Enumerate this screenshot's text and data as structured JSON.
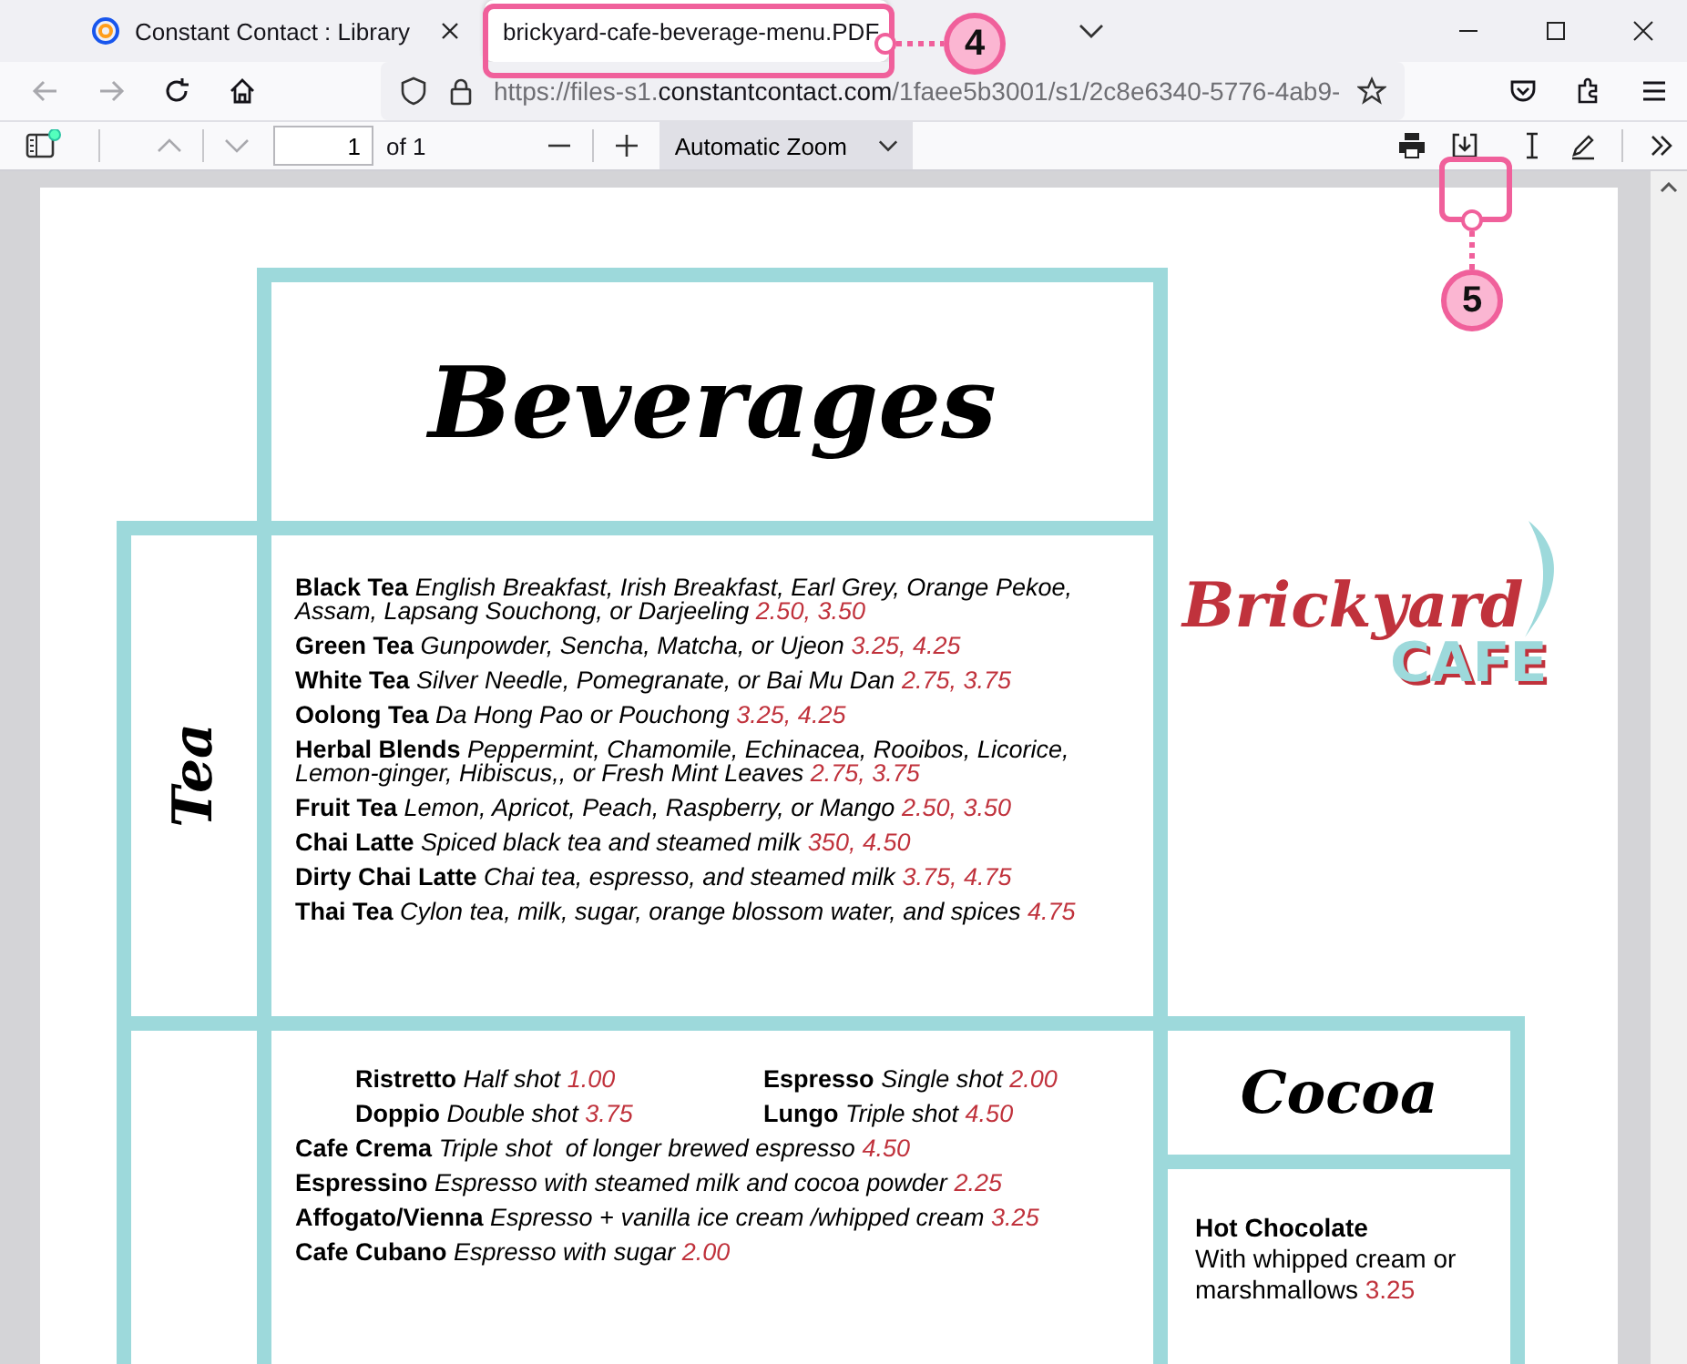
{
  "tabs": [
    {
      "title": "Constant Contact : Library",
      "selected": false
    },
    {
      "title": "brickyard-cafe-beverage-menu.PDF",
      "selected": true
    }
  ],
  "nav": {
    "back": {
      "disabled": true
    },
    "forward": {
      "disabled": true
    },
    "url": {
      "prefix": "https://files-s1.",
      "domain": "constantcontact.com",
      "path": "/1faee5b3001/s1/2c8e6340-5776-4ab9-"
    }
  },
  "pdf_toolbar": {
    "previous_page": {
      "disabled": true
    },
    "next_page": {
      "disabled": true
    },
    "page_input": "1",
    "page_count": "of 1",
    "zoom": "Automatic Zoom"
  },
  "menu": {
    "title": "Beverages",
    "tea": {
      "label": "Tea",
      "items": [
        {
          "name": "Black Tea",
          "description": "English Breakfast, Irish Breakfast, Earl Grey, Orange Pekoe, Assam, Lapsang Souchong, or Darjeeling",
          "price": "2.50, 3.50"
        },
        {
          "name": "Green Tea",
          "description": "Gunpowder, Sencha, Matcha, or Ujeon",
          "price": "3.25, 4.25"
        },
        {
          "name": "White Tea",
          "description": "Silver Needle, Pomegranate, or Bai Mu Dan",
          "price": "2.75, 3.75"
        },
        {
          "name": "Oolong Tea",
          "description": "Da Hong Pao or Pouchong",
          "price": "3.25, 4.25"
        },
        {
          "name": "Herbal Blends",
          "description": "Peppermint, Chamomile, Echinacea, Rooibos, Licorice, Lemon-ginger, Hibiscus,, or Fresh Mint Leaves",
          "price": "2.75, 3.75"
        },
        {
          "name": "Fruit Tea",
          "description": "Lemon, Apricot, Peach, Raspberry, or Mango",
          "price": "2.50, 3.50"
        },
        {
          "name": "Chai Latte",
          "description": "Spiced black tea and steamed milk",
          "price": "350, 4.50"
        },
        {
          "name": "Dirty Chai Latte",
          "description": "Chai tea, espresso, and steamed milk",
          "price": "3.75, 4.75"
        },
        {
          "name": "Thai Tea",
          "description": "Cylon tea, milk, sugar, orange blossom water, and spices",
          "price": "4.75"
        }
      ]
    },
    "coffee": {
      "shots": [
        {
          "name": "Ristretto",
          "description": "Half shot",
          "price": "1.00"
        },
        {
          "name": "Espresso",
          "description": "Single shot",
          "price": "2.00"
        },
        {
          "name": "Doppio",
          "description": "Double shot",
          "price": "3.75"
        },
        {
          "name": "Lungo",
          "description": "Triple shot",
          "price": "4.50"
        }
      ],
      "items": [
        {
          "name": "Cafe Crema",
          "description": "Triple shot  of longer brewed espresso",
          "price": "4.50"
        },
        {
          "name": "Espressino",
          "description": "Espresso with steamed milk and cocoa powder",
          "price": "2.25"
        },
        {
          "name": "Affogato/Vienna",
          "description": "Espresso + vanilla ice cream /whipped cream",
          "price": "3.25"
        },
        {
          "name": "Cafe Cubano",
          "description": "Espresso with sugar",
          "price": "2.00"
        }
      ]
    },
    "logo": {
      "line1": "Brickyard",
      "line2": "CAFE"
    },
    "cocoa": {
      "title": "Cocoa",
      "items": [
        {
          "name": "Hot Chocolate",
          "description": "With whipped cream or marshmallows",
          "price": "3.25"
        }
      ]
    }
  },
  "callouts": [
    {
      "label": "4"
    },
    {
      "label": "5"
    }
  ]
}
